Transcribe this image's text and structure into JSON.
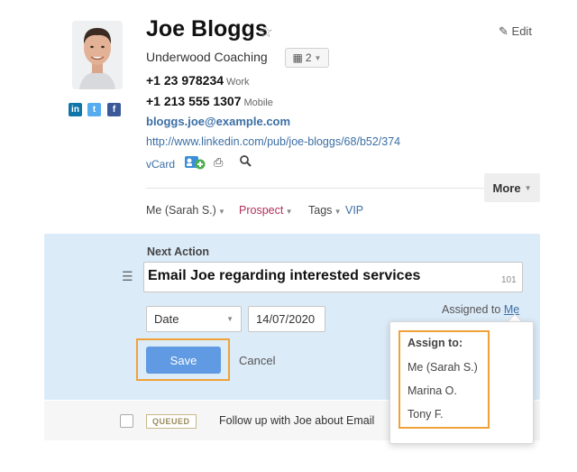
{
  "contact": {
    "name": "Joe Bloggs",
    "edit_label": "Edit",
    "company": "Underwood Coaching",
    "company_count": "2",
    "phones": [
      {
        "number": "+1 23 978234",
        "type": "Work"
      },
      {
        "number": "+1 213 555 1307",
        "type": "Mobile"
      }
    ],
    "email": "bloggs.joe@example.com",
    "url": "http://www.linkedin.com/pub/joe-bloggs/68/b52/374",
    "vcard_label": "vCard",
    "social": [
      {
        "icon": "linkedin-icon",
        "glyph": "in",
        "color": "#0e76a8"
      },
      {
        "icon": "twitter-icon",
        "glyph": "t",
        "color": "#55acee"
      },
      {
        "icon": "facebook-icon",
        "glyph": "f",
        "color": "#3b5998"
      }
    ]
  },
  "toolbar": {
    "more_label": "More"
  },
  "meta": {
    "owner": "Me (Sarah S.)",
    "status": "Prospect",
    "tags_label": "Tags",
    "tag": "VIP"
  },
  "next_action": {
    "label": "Next Action",
    "text": "Email Joe regarding interested services",
    "char_count": "101",
    "date_type": "Date",
    "date_value": "14/07/2020",
    "assigned_prefix": "Assigned to",
    "assigned_to": "Me",
    "save_label": "Save",
    "cancel_label": "Cancel"
  },
  "queued": {
    "badge": "QUEUED",
    "text": "Follow up with Joe about Email"
  },
  "assign_popover": {
    "title": "Assign to:",
    "options": [
      "Me (Sarah S.)",
      "Marina O.",
      "Tony F."
    ]
  },
  "colors": {
    "accent": "#3b6ea5",
    "highlight": "#f0a23a",
    "panel_bg": "#dcebf8",
    "save_button": "#5f9ae2",
    "prospect": "#b0305a"
  }
}
